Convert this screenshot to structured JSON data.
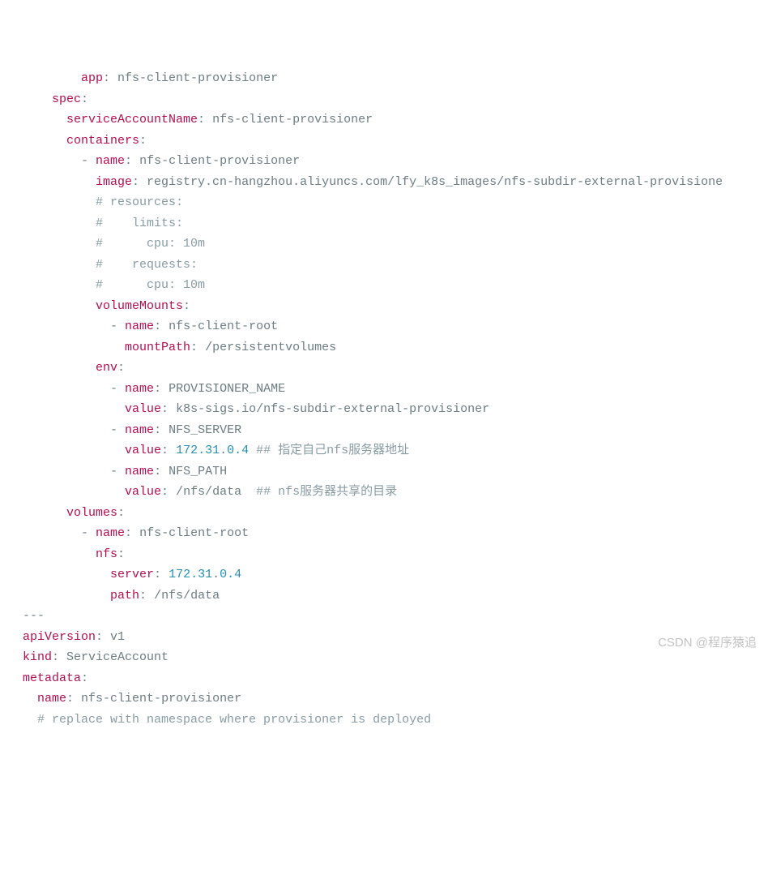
{
  "lines": [
    {
      "indent": "        ",
      "segs": [
        {
          "c": "key",
          "t": "app"
        },
        {
          "c": "txt",
          "t": ": "
        },
        {
          "c": "txt",
          "t": "nfs-client-provisioner"
        }
      ]
    },
    {
      "indent": "    ",
      "segs": [
        {
          "c": "key",
          "t": "spec"
        },
        {
          "c": "txt",
          "t": ":"
        }
      ]
    },
    {
      "indent": "      ",
      "segs": [
        {
          "c": "key",
          "t": "serviceAccountName"
        },
        {
          "c": "txt",
          "t": ": "
        },
        {
          "c": "txt",
          "t": "nfs-client-provisioner"
        }
      ]
    },
    {
      "indent": "      ",
      "segs": [
        {
          "c": "key",
          "t": "containers"
        },
        {
          "c": "txt",
          "t": ":"
        }
      ]
    },
    {
      "indent": "        ",
      "segs": [
        {
          "c": "dash",
          "t": "- "
        },
        {
          "c": "key",
          "t": "name"
        },
        {
          "c": "txt",
          "t": ": "
        },
        {
          "c": "txt",
          "t": "nfs-client-provisioner"
        }
      ]
    },
    {
      "indent": "          ",
      "segs": [
        {
          "c": "key",
          "t": "image"
        },
        {
          "c": "txt",
          "t": ": "
        },
        {
          "c": "txt",
          "t": "registry.cn-hangzhou.aliyuncs.com/lfy_k8s_images/nfs-subdir-external-provisione"
        }
      ]
    },
    {
      "indent": "          ",
      "segs": [
        {
          "c": "cmt",
          "t": "# resources:"
        }
      ]
    },
    {
      "indent": "          ",
      "segs": [
        {
          "c": "cmt",
          "t": "#    limits:"
        }
      ]
    },
    {
      "indent": "          ",
      "segs": [
        {
          "c": "cmt",
          "t": "#      cpu: 10m"
        }
      ]
    },
    {
      "indent": "          ",
      "segs": [
        {
          "c": "cmt",
          "t": "#    requests:"
        }
      ]
    },
    {
      "indent": "          ",
      "segs": [
        {
          "c": "cmt",
          "t": "#      cpu: 10m"
        }
      ]
    },
    {
      "indent": "          ",
      "segs": [
        {
          "c": "key",
          "t": "volumeMounts"
        },
        {
          "c": "txt",
          "t": ":"
        }
      ]
    },
    {
      "indent": "            ",
      "segs": [
        {
          "c": "dash",
          "t": "- "
        },
        {
          "c": "key",
          "t": "name"
        },
        {
          "c": "txt",
          "t": ": "
        },
        {
          "c": "txt",
          "t": "nfs-client-root"
        }
      ]
    },
    {
      "indent": "              ",
      "segs": [
        {
          "c": "key",
          "t": "mountPath"
        },
        {
          "c": "txt",
          "t": ": "
        },
        {
          "c": "txt",
          "t": "/persistentvolumes"
        }
      ]
    },
    {
      "indent": "          ",
      "segs": [
        {
          "c": "key",
          "t": "env"
        },
        {
          "c": "txt",
          "t": ":"
        }
      ]
    },
    {
      "indent": "            ",
      "segs": [
        {
          "c": "dash",
          "t": "- "
        },
        {
          "c": "key",
          "t": "name"
        },
        {
          "c": "txt",
          "t": ": "
        },
        {
          "c": "txt",
          "t": "PROVISIONER_NAME"
        }
      ]
    },
    {
      "indent": "              ",
      "segs": [
        {
          "c": "key",
          "t": "value"
        },
        {
          "c": "txt",
          "t": ": "
        },
        {
          "c": "txt",
          "t": "k8s-sigs.io/nfs-subdir-external-provisioner"
        }
      ]
    },
    {
      "indent": "            ",
      "segs": [
        {
          "c": "dash",
          "t": "- "
        },
        {
          "c": "key",
          "t": "name"
        },
        {
          "c": "txt",
          "t": ": "
        },
        {
          "c": "txt",
          "t": "NFS_SERVER"
        }
      ]
    },
    {
      "indent": "              ",
      "segs": [
        {
          "c": "key",
          "t": "value"
        },
        {
          "c": "txt",
          "t": ": "
        },
        {
          "c": "num",
          "t": "172.31"
        },
        {
          "c": "txt",
          "t": "."
        },
        {
          "c": "num",
          "t": "0.4"
        },
        {
          "c": "txt",
          "t": " "
        },
        {
          "c": "cmt",
          "t": "## 指定自己nfs服务器地址"
        }
      ]
    },
    {
      "indent": "            ",
      "segs": [
        {
          "c": "dash",
          "t": "- "
        },
        {
          "c": "key",
          "t": "name"
        },
        {
          "c": "txt",
          "t": ": "
        },
        {
          "c": "txt",
          "t": "NFS_PATH  "
        }
      ]
    },
    {
      "indent": "              ",
      "segs": [
        {
          "c": "key",
          "t": "value"
        },
        {
          "c": "txt",
          "t": ": "
        },
        {
          "c": "txt",
          "t": "/nfs/data  "
        },
        {
          "c": "cmt",
          "t": "## nfs服务器共享的目录"
        }
      ]
    },
    {
      "indent": "      ",
      "segs": [
        {
          "c": "key",
          "t": "volumes"
        },
        {
          "c": "txt",
          "t": ":"
        }
      ]
    },
    {
      "indent": "        ",
      "segs": [
        {
          "c": "dash",
          "t": "- "
        },
        {
          "c": "key",
          "t": "name"
        },
        {
          "c": "txt",
          "t": ": "
        },
        {
          "c": "txt",
          "t": "nfs-client-root"
        }
      ]
    },
    {
      "indent": "          ",
      "segs": [
        {
          "c": "key",
          "t": "nfs"
        },
        {
          "c": "txt",
          "t": ":"
        }
      ]
    },
    {
      "indent": "            ",
      "segs": [
        {
          "c": "key",
          "t": "server"
        },
        {
          "c": "txt",
          "t": ": "
        },
        {
          "c": "num",
          "t": "172.31"
        },
        {
          "c": "txt",
          "t": "."
        },
        {
          "c": "num",
          "t": "0.4"
        }
      ]
    },
    {
      "indent": "            ",
      "segs": [
        {
          "c": "key",
          "t": "path"
        },
        {
          "c": "txt",
          "t": ": "
        },
        {
          "c": "txt",
          "t": "/nfs/data"
        }
      ]
    },
    {
      "indent": "",
      "segs": [
        {
          "c": "docsep",
          "t": "---"
        }
      ]
    },
    {
      "indent": "",
      "segs": [
        {
          "c": "key",
          "t": "apiVersion"
        },
        {
          "c": "txt",
          "t": ": "
        },
        {
          "c": "txt",
          "t": "v1"
        }
      ]
    },
    {
      "indent": "",
      "segs": [
        {
          "c": "key",
          "t": "kind"
        },
        {
          "c": "txt",
          "t": ": "
        },
        {
          "c": "txt",
          "t": "ServiceAccount"
        }
      ]
    },
    {
      "indent": "",
      "segs": [
        {
          "c": "key",
          "t": "metadata"
        },
        {
          "c": "txt",
          "t": ":"
        }
      ]
    },
    {
      "indent": "  ",
      "segs": [
        {
          "c": "key",
          "t": "name"
        },
        {
          "c": "txt",
          "t": ": "
        },
        {
          "c": "txt",
          "t": "nfs-client-provisioner"
        }
      ]
    },
    {
      "indent": "  ",
      "segs": [
        {
          "c": "cmt",
          "t": "# replace with namespace where provisioner is deployed"
        }
      ]
    }
  ],
  "watermark": "CSDN @程序猿追"
}
